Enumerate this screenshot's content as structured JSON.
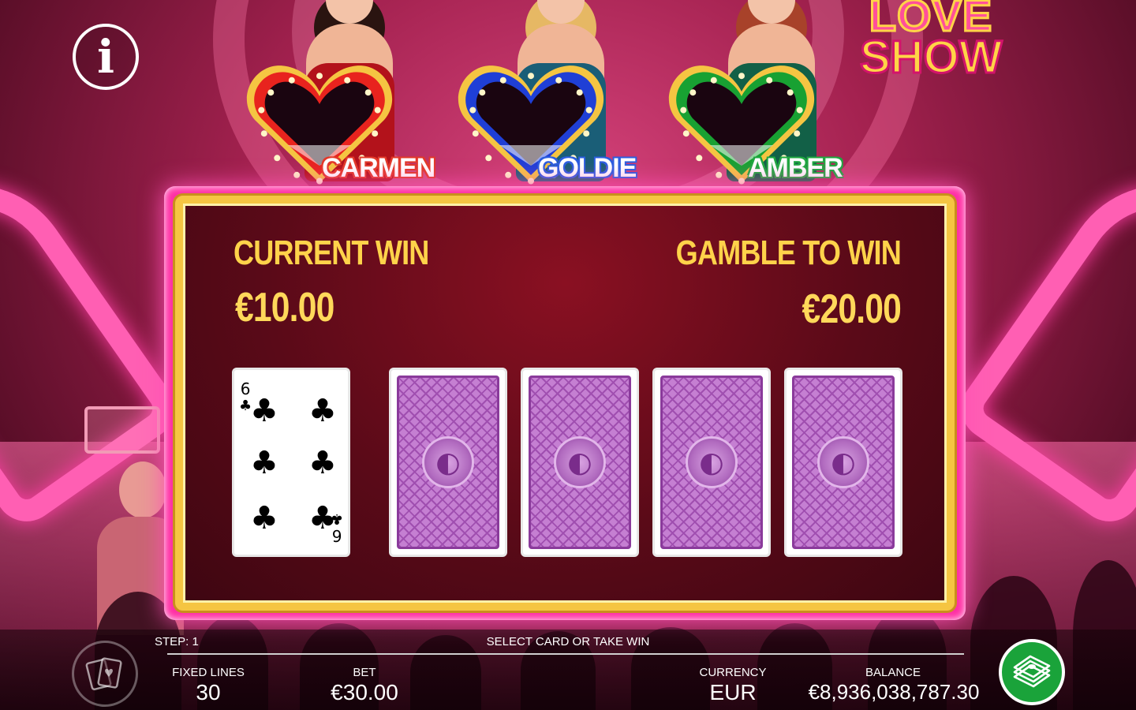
{
  "game": {
    "logo_line1": "LOVE",
    "logo_line2": "SHOW"
  },
  "hosts": [
    {
      "name": "CARMEN",
      "frame_color": "#e8231e",
      "dress_color": "#b3121b",
      "hair_color": "#2a1410",
      "name_color": "#e23a2a"
    },
    {
      "name": "GOLDIE",
      "frame_color": "#1f3fd6",
      "dress_color": "#1a5e77",
      "hair_color": "#e6b864",
      "name_color": "#2c5fe0"
    },
    {
      "name": "AMBER",
      "frame_color": "#18a132",
      "dress_color": "#126047",
      "hair_color": "#a8422a",
      "name_color": "#1fa840"
    }
  ],
  "panel": {
    "current_win_label": "CURRENT WIN",
    "current_win_value": "€10.00",
    "gamble_to_win_label": "GAMBLE TO WIN",
    "gamble_to_win_value": "€20.00"
  },
  "cards": {
    "revealed": {
      "rank": "6",
      "suit": "♣"
    },
    "hidden_count": 4
  },
  "status": {
    "step_label": "STEP: 1",
    "message": "SELECT CARD OR TAKE WIN"
  },
  "footer": {
    "fixed_lines_label": "FIXED LINES",
    "fixed_lines_value": "30",
    "bet_label": "BET",
    "bet_value": "€30.00",
    "currency_label": "CURRENCY",
    "currency_value": "EUR",
    "balance_label": "BALANCE",
    "balance_value": "€8,936,038,787.30"
  },
  "icons": {
    "info": "info-icon",
    "gamble": "cards-heart-icon",
    "collect": "cash-stack-icon"
  },
  "colors": {
    "panel_gold": "#f5c542",
    "panel_pink": "#ff2fa4",
    "label_gold": "#ffd34a",
    "collect_green": "#1aa33a"
  }
}
